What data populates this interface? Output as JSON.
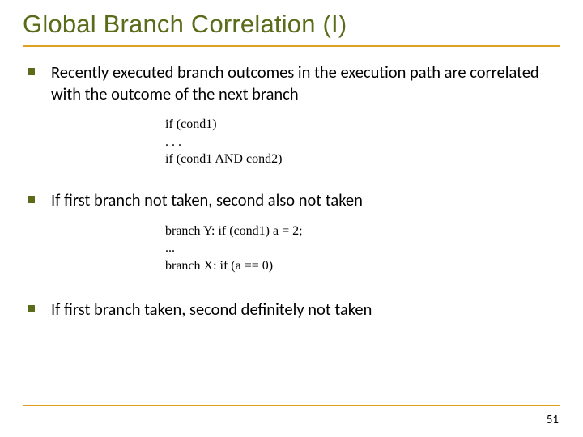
{
  "slide": {
    "title": "Global Branch Correlation (I)",
    "bullets": [
      "Recently executed branch outcomes in the execution path are correlated with the outcome of the next branch",
      "If first branch not taken, second also not taken",
      "If first branch taken, second definitely not taken"
    ],
    "code1": "if (cond1)\n. . .\nif (cond1 AND cond2)",
    "code2": "branch Y: if (cond1) a = 2;\n...\nbranch X: if (a == 0)",
    "page_number": "51"
  }
}
